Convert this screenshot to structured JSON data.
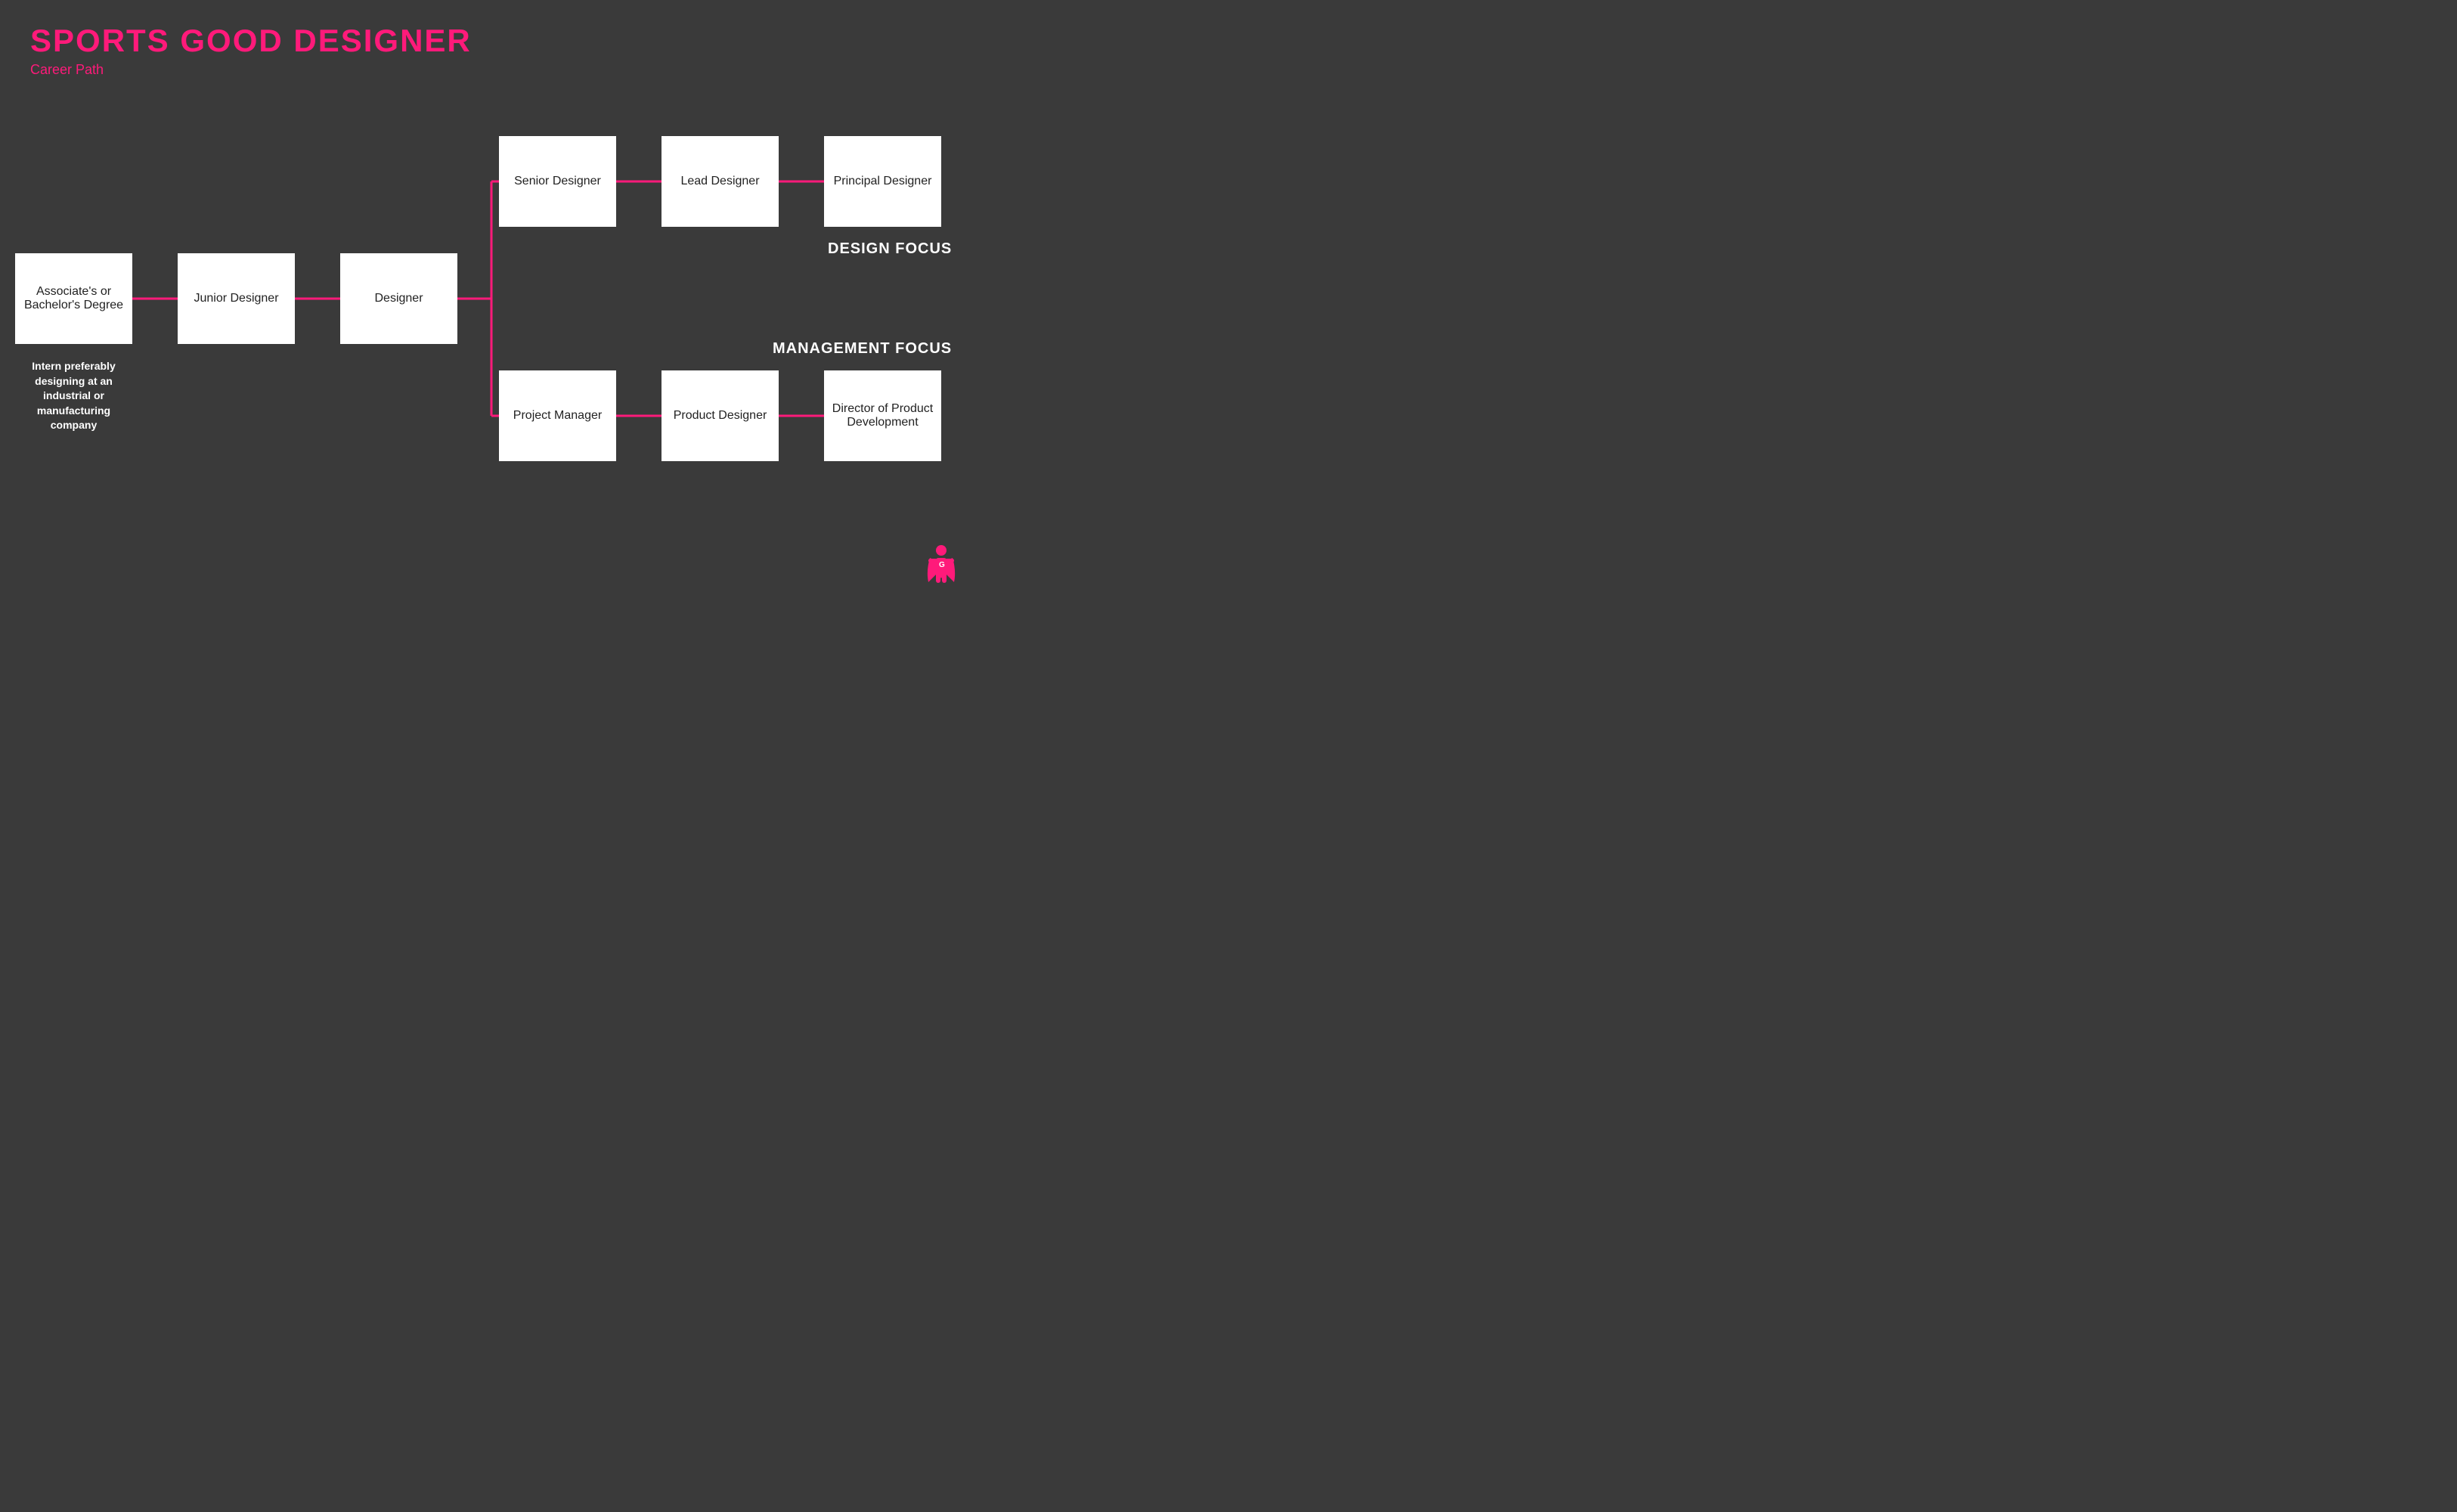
{
  "header": {
    "main_title": "SPORTS GOOD DESIGNER",
    "sub_title": "Career Path"
  },
  "boxes": {
    "degree": "Associate's or Bachelor's Degree",
    "junior": "Junior Designer",
    "designer": "Designer",
    "senior": "Senior Designer",
    "lead": "Lead Designer",
    "principal": "Principal Designer",
    "project": "Project Manager",
    "product": "Product Designer",
    "director": "Director of Product Development"
  },
  "labels": {
    "design_focus": "DESIGN FOCUS",
    "management_focus": "MANAGEMENT FOCUS"
  },
  "intern_note": "Intern preferably designing at an industrial or manufacturing company",
  "colors": {
    "accent": "#ff1a7a",
    "background": "#3a3a3a",
    "box_bg": "#ffffff",
    "text_dark": "#222222",
    "text_light": "#ffffff"
  }
}
